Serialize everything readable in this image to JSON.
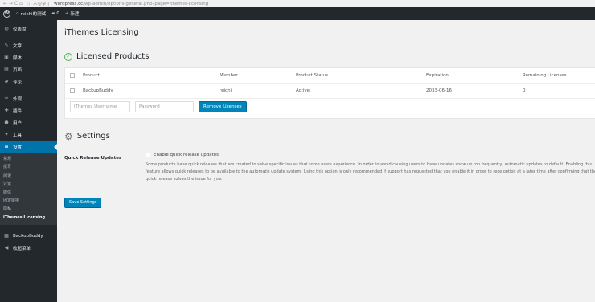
{
  "browser": {
    "nav_glyphs": "←  →  C  ⌂",
    "security": "ⓘ 不安全 |",
    "url_host": "wordpress.cc",
    "url_path": "/wp-admin/options-general.php?page=ithemes-licensing"
  },
  "admin_bar": {
    "site_name": "reichi的测试",
    "comments_count": "0",
    "new_label": "新建"
  },
  "sidebar": {
    "top_items": [
      {
        "icon": "dashboard-icon",
        "label": "仪表盘"
      },
      {
        "icon": "pin-icon",
        "label": "文章"
      },
      {
        "icon": "media-icon",
        "label": "媒体"
      },
      {
        "icon": "page-icon",
        "label": "页面"
      },
      {
        "icon": "comment-icon",
        "label": "评论"
      },
      {
        "icon": "appearance-icon",
        "label": "外观"
      },
      {
        "icon": "plugin-icon",
        "label": "插件"
      },
      {
        "icon": "users-icon",
        "label": "用户"
      },
      {
        "icon": "tools-icon",
        "label": "工具"
      }
    ],
    "current_item": {
      "icon": "settings-icon",
      "label": "设置"
    },
    "submenu": [
      "常规",
      "撰写",
      "阅读",
      "讨论",
      "媒体",
      "固定链接",
      "隐私",
      "iThemes Licensing"
    ],
    "bottom_items": [
      {
        "icon": "backupbuddy-icon",
        "label": "BackupBuddy"
      },
      {
        "icon": "collapse-icon",
        "label": "收起菜单"
      }
    ]
  },
  "page": {
    "title": "iThemes Licensing",
    "licensed_heading": "Licensed Products",
    "table": {
      "headers": [
        "Product",
        "Member",
        "Product Status",
        "Expiration",
        "Remaining Licenses"
      ],
      "rows": [
        [
          "BackupBuddy",
          "reichi",
          "Active",
          "2033-06-16",
          "0"
        ]
      ]
    },
    "username_placeholder": "iThemes Username",
    "password_placeholder": "Password",
    "remove_button": "Remove Licenses",
    "settings_heading": "Settings",
    "quick_release_label": "Quick Release Updates",
    "quick_release_checkbox": "Enable quick release updates",
    "quick_release_desc": "Some products have quick releases that are created to solve specific issues that some users experience. In order to avoid causing users to have updates show up too frequently, automatic updates to default. Enabling this feature allows quick releases to be available to the automatic update system. Using this option is only recommended if support has requested that you enable it in order to rece option at a later time after confirming that the quick release solves the issue for you.",
    "save_button": "Save Settings"
  },
  "colors": {
    "sidebar_bg": "#23282d",
    "current_menu": "#0073aa",
    "primary_button": "#0085ba",
    "success": "#46b450"
  }
}
